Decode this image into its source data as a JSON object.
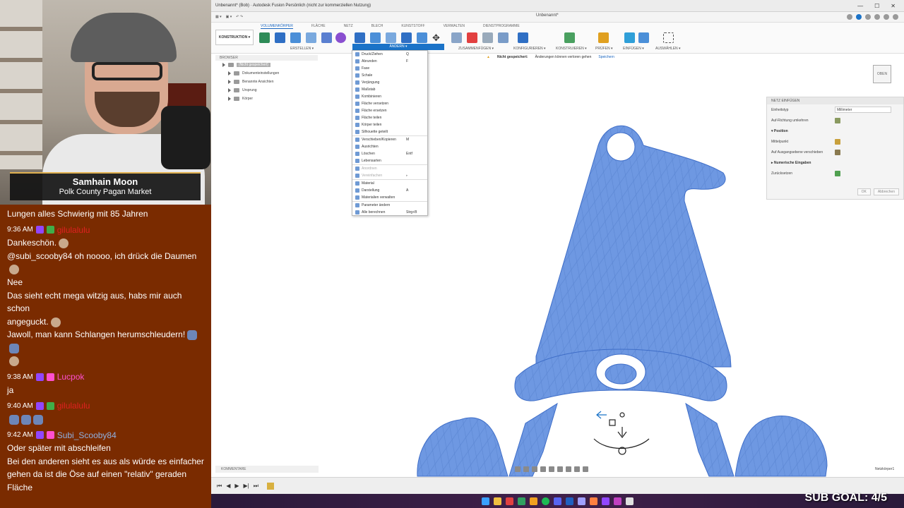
{
  "stream": {
    "name": "Samhain Moon",
    "subtitle": "Polk County Pagan Market",
    "sub_goal": "SUB GOAL: 4/5"
  },
  "chat": {
    "messages": [
      {
        "type": "text",
        "text": "Lungen alles Schwierig mit 85 Jahren"
      },
      {
        "type": "meta",
        "time": "9:36 AM",
        "user": "gilulalulu",
        "user_color": "#e02020"
      },
      {
        "type": "text",
        "text": "Dankeschön."
      },
      {
        "type": "text",
        "text": "@subi_scooby84 oh noooo, ich drück die Daumen"
      },
      {
        "type": "text",
        "text": "Nee"
      },
      {
        "type": "text",
        "text": "Das sieht echt mega witzig aus, habs mir auch schon"
      },
      {
        "type": "text",
        "text": "angeguckt."
      },
      {
        "type": "text",
        "text": "Jawoll, man kann Schlangen herumschleudern!"
      },
      {
        "type": "meta",
        "time": "9:38 AM",
        "user": "Lucpok",
        "user_color": "#ff4fd0"
      },
      {
        "type": "text",
        "text": "ja"
      },
      {
        "type": "meta",
        "time": "9:40 AM",
        "user": "gilulalulu",
        "user_color": "#e02020"
      },
      {
        "type": "meta",
        "time": "9:42 AM",
        "user": "Subi_Scooby84",
        "user_color": "#8fb0e0"
      },
      {
        "type": "text",
        "text": "Oder später mit abschleifen"
      },
      {
        "type": "text",
        "text": "Bei den anderen sieht es aus als würde es einfacher"
      },
      {
        "type": "text",
        "text": "gehen da ist die Öse auf einen \"relativ\" geraden Fläche"
      }
    ]
  },
  "fusion": {
    "window_title": "Unbenannt* (Bob) · Autodesk Fusion Persönlich (nicht zur kommerziellen Nutzung)",
    "doc_tab": "Unbenannt*",
    "workspace": "KONSTRUKTION ▾",
    "ribbon_tabs": [
      "VOLUMENKÖRPER",
      "FLÄCHE",
      "NETZ",
      "BLECH",
      "KUNSTSTOFF",
      "VERWALTEN",
      "DIENSTPROGRAMME"
    ],
    "groups": [
      "ERSTELLEN ▾",
      "ZUSAMMENFÜGEN ▾",
      "KONFIGURIEREN ▾",
      "KONSTRUIEREN ▾",
      "PRÜFEN ▾",
      "EINFÜGEN ▾",
      "AUSWÄHLEN ▾"
    ],
    "modify_label": "ÄNDERN ▾",
    "menu": [
      {
        "label": "Druck/Ziehen",
        "key": "Q"
      },
      {
        "label": "Abrunden",
        "key": "F"
      },
      {
        "label": "Fase",
        "key": ""
      },
      {
        "label": "Schale",
        "key": ""
      },
      {
        "label": "Verjüngung",
        "key": ""
      },
      {
        "label": "Maßstab",
        "key": ""
      },
      {
        "label": "Kombinieren",
        "key": ""
      },
      {
        "label": "Fläche versetzen",
        "key": ""
      },
      {
        "label": "Fläche ersetzen",
        "key": ""
      },
      {
        "label": "Fläche teilen",
        "key": ""
      },
      {
        "label": "Körper teilen",
        "key": ""
      },
      {
        "label": "Silhouette geteilt",
        "key": ""
      },
      {
        "label": "sep"
      },
      {
        "label": "Verschieben/Kopieren",
        "key": "M"
      },
      {
        "label": "Ausrichten",
        "key": ""
      },
      {
        "label": "Löschen",
        "key": "Entf"
      },
      {
        "label": "Lebensarten",
        "key": ""
      },
      {
        "label": "sep"
      },
      {
        "label": "Anordnen",
        "key": ""
      },
      {
        "label": "Vereinfachen",
        "key": "▸"
      },
      {
        "label": "sep"
      },
      {
        "label": "Material",
        "key": ""
      },
      {
        "label": "Darstellung",
        "key": "A"
      },
      {
        "label": "Materialien verwalten",
        "key": ""
      },
      {
        "label": "sep"
      },
      {
        "label": "Parameter ändern",
        "key": ""
      },
      {
        "label": "Alle berechnen",
        "key": "Strg+B"
      }
    ],
    "browser": {
      "header": "BROWSER",
      "root": "(Nicht gespeichert)",
      "items": [
        "Dokumenteinstellungen",
        "Benannte Ansichten",
        "Ursprung",
        "Körper"
      ]
    },
    "warning": {
      "label": "Nicht gespeichert:",
      "text": "Änderungen können verloren gehen",
      "save": "Speichern"
    },
    "viewcube": "OBEN",
    "panel": {
      "title": "NETZ EINFÜGEN",
      "unit_label": "Einheitstyp",
      "unit_value": "Millimeter",
      "flip": "Auf-Richtung umkehren",
      "position": "Position",
      "center": "Mittelpunkt",
      "move_plane": "Auf Ausgangsebene verschieben",
      "numeric": "Numerische Eingaben",
      "reset": "Zurücksetzen",
      "ok": "OK",
      "cancel": "Abbrechen"
    },
    "comments": "KOMMENTARE",
    "mesh_body": "Netzkörper1"
  },
  "colors": {
    "mesh_fill": "#6e98e2",
    "mesh_stroke": "#3f6ec8",
    "accent": "#1b73c8",
    "chat_bg": "#7a2b00"
  }
}
